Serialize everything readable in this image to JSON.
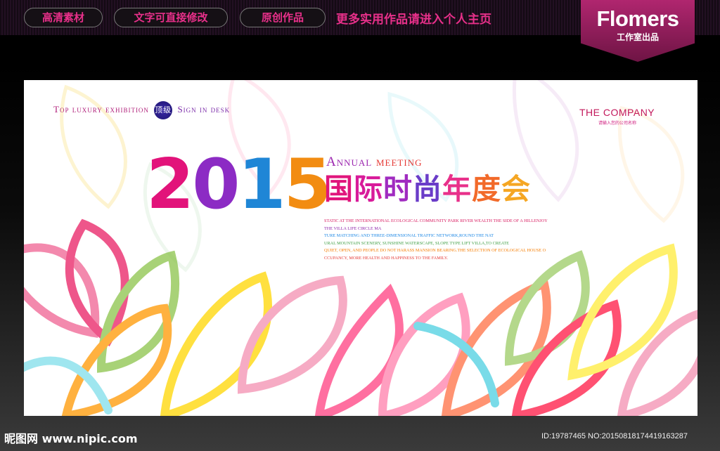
{
  "header": {
    "pills": [
      "高清素材",
      "文字可直接修改",
      "原创作品"
    ],
    "link": "更多实用作品请进入个人主页",
    "badge": {
      "title": "Flomers",
      "subtitle": "工作室出品"
    }
  },
  "poster": {
    "tagline_left": "Top luxury exhibition",
    "tagline_mid": "顶级",
    "tagline_right": "Sign in desk",
    "company": "THE COMPANY",
    "company_sub": "请输入您的公司名称",
    "year_digits": [
      "2",
      "0",
      "1",
      "5"
    ],
    "annual_part1": "Annual",
    "annual_part2": "meeting",
    "title_chars": [
      "国",
      "际",
      "时",
      "尚",
      "年",
      "度",
      "会"
    ],
    "paragraph": [
      "STATIC AT THE INTERNATIONAL ECOLOGICAL COMMUNITY PARK RIVER WEALTH THE SIDE OF A HILLENJOY",
      "THE VILLA LIFE CIRCLE MA",
      "TURE MATCHING AND THREE-DIMENSIONAL TRAFFIC NETWORK,ROUND THE NAT",
      "URAL MOUNTAIN SCENERY, SUNSHINE WATERSCAPE, SLOPE TYPE LIFT VILLA,TO CREATE",
      "QUIET, OPEN, AND PEOPLE DO NOT HARASS MANSION BEARING.THE SELECTION OF ECOLOGICAL HOUSE O",
      "CCUPANCY, MORE HEALTH AND HAPPINESS TO THE FAMILY."
    ]
  },
  "footer": {
    "logo_text": "昵图网 www.nipic.com",
    "id_text": "ID:19787465 NO:20150818174419163287"
  }
}
